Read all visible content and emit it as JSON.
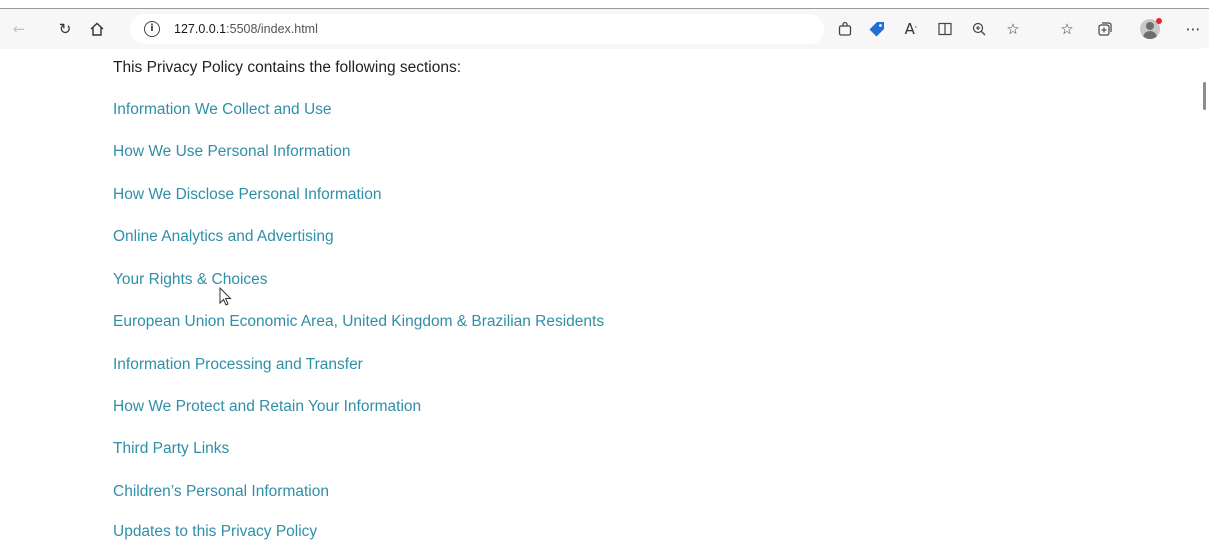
{
  "browser": {
    "url_host": "127.0.0.1",
    "url_path": ":5508/index.html",
    "nav_icons": [
      "back-arrow-icon",
      "refresh-icon",
      "home-icon"
    ],
    "toolbar_icons": [
      "shopping-bag-icon",
      "tag-icon",
      "read-aloud-icon",
      "immersive-reader-icon",
      "zoom-icon",
      "favorite-add-icon",
      "favorites-icon",
      "collections-icon",
      "profile-avatar",
      "more-icon"
    ],
    "colors": {
      "toolbar_bg": "#f7f7f7",
      "tag_icon": "#1f6fd6",
      "notification_dot": "#e0282e"
    }
  },
  "page": {
    "intro": "This Privacy Policy contains the following sections:",
    "link_color": "#2f8fa8",
    "sections": [
      "Information We Collect and Use",
      "How We Use Personal Information",
      "How We Disclose Personal Information",
      "Online Analytics and Advertising",
      "Your Rights & Choices",
      "European Union Economic Area, United Kingdom & Brazilian Residents",
      "Information Processing and Transfer",
      "How We Protect and Retain Your Information",
      "Third Party Links",
      "Children’s Personal Information",
      "Updates to this Privacy Policy"
    ]
  }
}
